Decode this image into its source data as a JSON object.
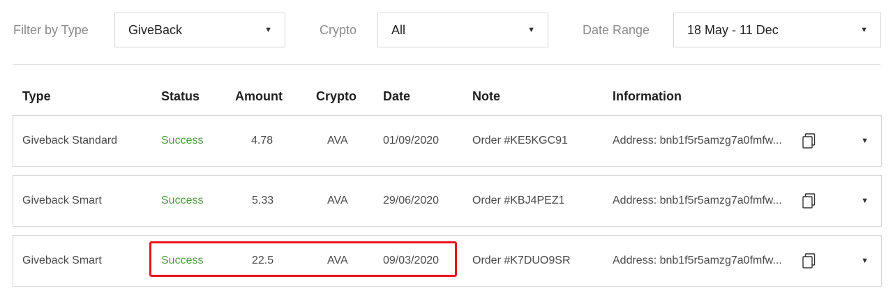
{
  "filters": {
    "type_label": "Filter by Type",
    "type_value": "GiveBack",
    "crypto_label": "Crypto",
    "crypto_value": "All",
    "date_label": "Date Range",
    "date_value": "18 May - 11 Dec"
  },
  "table": {
    "headers": {
      "type": "Type",
      "status": "Status",
      "amount": "Amount",
      "crypto": "Crypto",
      "date": "Date",
      "note": "Note",
      "information": "Information"
    },
    "rows": [
      {
        "type": "Giveback Standard",
        "status": "Success",
        "amount": "4.78",
        "crypto": "AVA",
        "date": "01/09/2020",
        "note": "Order #KE5KGC91",
        "information": "Address: bnb1f5r5amzg7a0fmfw..."
      },
      {
        "type": "Giveback Smart",
        "status": "Success",
        "amount": "5.33",
        "crypto": "AVA",
        "date": "29/06/2020",
        "note": "Order #KBJ4PEZ1",
        "information": "Address: bnb1f5r5amzg7a0fmfw..."
      },
      {
        "type": "Giveback Smart",
        "status": "Success",
        "amount": "22.5",
        "crypto": "AVA",
        "date": "09/03/2020",
        "note": "Order #K7DUO9SR",
        "information": "Address: bnb1f5r5amzg7a0fmfw..."
      }
    ]
  },
  "colors": {
    "status_success": "#4a9d3a",
    "highlight": "#e8141b"
  },
  "icons": {
    "select_caret": "▼",
    "row_expand": "▼",
    "copy": "copy-icon"
  }
}
